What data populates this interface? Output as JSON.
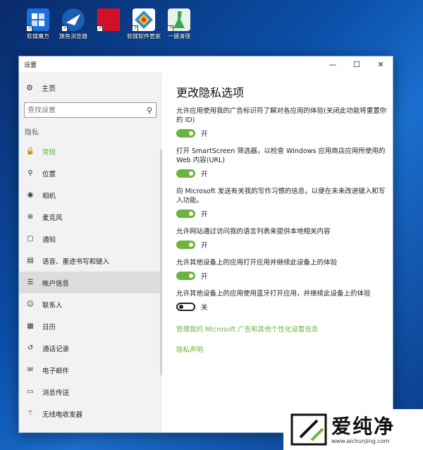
{
  "desktop": {
    "icons": [
      {
        "label": "软媒魔方",
        "color": "#1e6fd9"
      },
      {
        "label": "旗鱼浏览器",
        "color": "#1a5fb4"
      },
      {
        "label": "",
        "color": "#d2102a"
      },
      {
        "label": "软媒软件管家",
        "color": "#2a8cd8"
      },
      {
        "label": "一键清理",
        "color": "#3aa25a"
      }
    ]
  },
  "window": {
    "title": "设置",
    "minimize": "—",
    "maximize": "☐",
    "close": "✕"
  },
  "sidebar": {
    "home_label": "主页",
    "search_placeholder": "查找设置",
    "section_label": "隐私",
    "items": [
      {
        "label": "常规",
        "icon": "lock-icon",
        "glyph": "🔒"
      },
      {
        "label": "位置",
        "icon": "location-icon",
        "glyph": "⚲"
      },
      {
        "label": "相机",
        "icon": "camera-icon",
        "glyph": "◉"
      },
      {
        "label": "麦克风",
        "icon": "microphone-icon",
        "glyph": "⊕"
      },
      {
        "label": "通知",
        "icon": "notification-icon",
        "glyph": "▢"
      },
      {
        "label": "语音、墨迹书写和键入",
        "icon": "notepad-icon",
        "glyph": "▤"
      },
      {
        "label": "帐户信息",
        "icon": "account-info-icon",
        "glyph": "☰"
      },
      {
        "label": "联系人",
        "icon": "contacts-icon",
        "glyph": "☺"
      },
      {
        "label": "日历",
        "icon": "calendar-icon",
        "glyph": "▦"
      },
      {
        "label": "通话记录",
        "icon": "call-history-icon",
        "glyph": "↺"
      },
      {
        "label": "电子邮件",
        "icon": "email-icon",
        "glyph": "✉"
      },
      {
        "label": "消息传送",
        "icon": "messaging-icon",
        "glyph": "▭"
      },
      {
        "label": "无线电收发器",
        "icon": "radio-icon",
        "glyph": "⚚"
      }
    ]
  },
  "main": {
    "heading": "更改隐私选项",
    "options": [
      {
        "desc": "允许应用使用我的广告标识符了解对各应用的体验(关闭此功能将重置你的 ID)",
        "state": "开",
        "on": true
      },
      {
        "desc": "打开 SmartScreen 筛选器，以检查 Windows 应用商店应用所使用的 Web 内容(URL)",
        "state": "开",
        "on": true
      },
      {
        "desc": "向 Microsoft 发送有关我的写作习惯的信息，以便在未来改进键入和写入功能。",
        "state": "开",
        "on": true
      },
      {
        "desc": "允许网站通过访问我的语言列表来提供本地相关内容",
        "state": "开",
        "on": true
      },
      {
        "desc": "允许其他设备上的应用打开应用并继续此设备上的体验",
        "state": "开",
        "on": true
      },
      {
        "desc": "允许其他设备上的应用使用蓝牙打开应用，并继续此设备上的体验",
        "state": "关",
        "on": false
      }
    ],
    "link_ads": "管理我的 Microsoft 广告和其他个性化设置信息",
    "link_privacy": "隐私声明"
  },
  "watermark": {
    "brand": "爱纯净",
    "url": "www.aichunjing.com"
  },
  "colors": {
    "accent": "#6db33f"
  }
}
